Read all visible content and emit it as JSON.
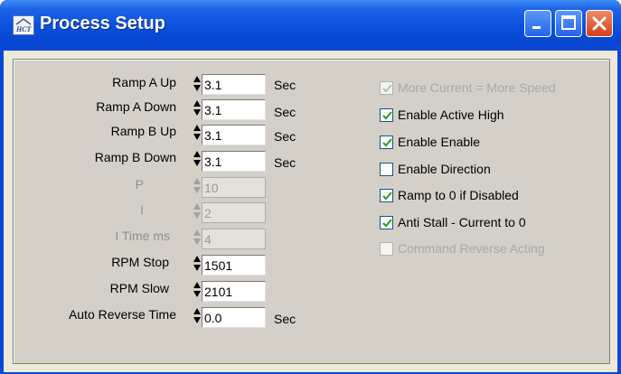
{
  "window": {
    "title": "Process Setup",
    "app_icon": "HCT",
    "controls": [
      "minimize-icon",
      "maximize-icon",
      "close-icon"
    ]
  },
  "params": [
    {
      "label": "Ramp A Up",
      "value": "3.1",
      "unit": "Sec",
      "enabled": true
    },
    {
      "label": "Ramp A Down",
      "value": "3.1",
      "unit": "Sec",
      "enabled": true
    },
    {
      "label": "Ramp B Up",
      "value": "3.1",
      "unit": "Sec",
      "enabled": true
    },
    {
      "label": "Ramp B Down",
      "value": "3.1",
      "unit": "Sec",
      "enabled": true
    },
    {
      "label": "P",
      "value": "10",
      "unit": "",
      "enabled": false
    },
    {
      "label": "I",
      "value": "2",
      "unit": "",
      "enabled": false
    },
    {
      "label": "I Time ms",
      "value": "4",
      "unit": "",
      "enabled": false
    },
    {
      "label": "RPM Stop",
      "value": "1501",
      "unit": "",
      "enabled": true
    },
    {
      "label": "RPM Slow",
      "value": "2101",
      "unit": "",
      "enabled": true
    },
    {
      "label": "Auto Reverse Time",
      "value": "0.0",
      "unit": "Sec",
      "enabled": true
    }
  ],
  "options": [
    {
      "label": "More Current = More Speed",
      "checked": true,
      "enabled": false
    },
    {
      "label": "Enable Active High",
      "checked": true,
      "enabled": true
    },
    {
      "label": "Enable Enable",
      "checked": true,
      "enabled": true
    },
    {
      "label": "Enable Direction",
      "checked": false,
      "enabled": true
    },
    {
      "label": "Ramp to 0 if Disabled",
      "checked": true,
      "enabled": true
    },
    {
      "label": "Anti Stall - Current to 0",
      "checked": true,
      "enabled": true
    },
    {
      "label": "Command Reverse Acting",
      "checked": false,
      "enabled": false
    }
  ],
  "colors": {
    "titlebar": "#0a4fdc",
    "panel": "#d4d0c8",
    "check_enabled": "#21a121",
    "check_disabled": "#a9c7a9",
    "disabled_text": "#8f8f8f"
  }
}
